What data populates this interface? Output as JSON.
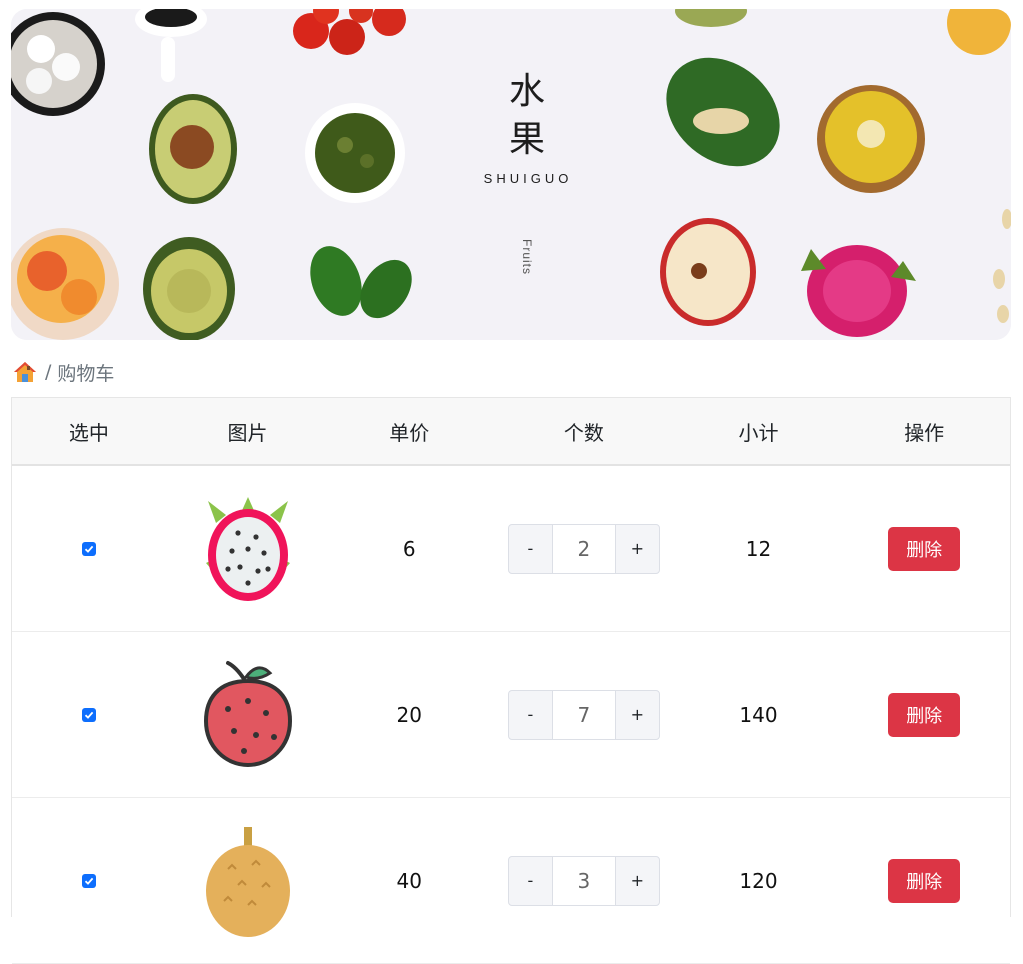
{
  "banner": {
    "title_line1": "水",
    "title_line2": "果",
    "subtitle": "SHUIGUO",
    "vertical": "Fruits"
  },
  "breadcrumb": {
    "home_icon": "house-icon",
    "separator": "/",
    "current": "购物车"
  },
  "table": {
    "headers": [
      "选中",
      "图片",
      "单价",
      "个数",
      "小计",
      "操作"
    ],
    "rows": [
      {
        "checked": true,
        "image": "dragonfruit-icon",
        "price": "6",
        "qty": "2",
        "subtotal": "12",
        "action": "删除"
      },
      {
        "checked": true,
        "image": "lychee-icon",
        "price": "20",
        "qty": "7",
        "subtotal": "140",
        "action": "删除"
      },
      {
        "checked": true,
        "image": "durian-icon",
        "price": "40",
        "qty": "3",
        "subtotal": "120",
        "action": "删除"
      }
    ],
    "minus_label": "-",
    "plus_label": "+"
  },
  "colors": {
    "checkbox": "#0d6efd",
    "delete_button": "#dc3545"
  }
}
